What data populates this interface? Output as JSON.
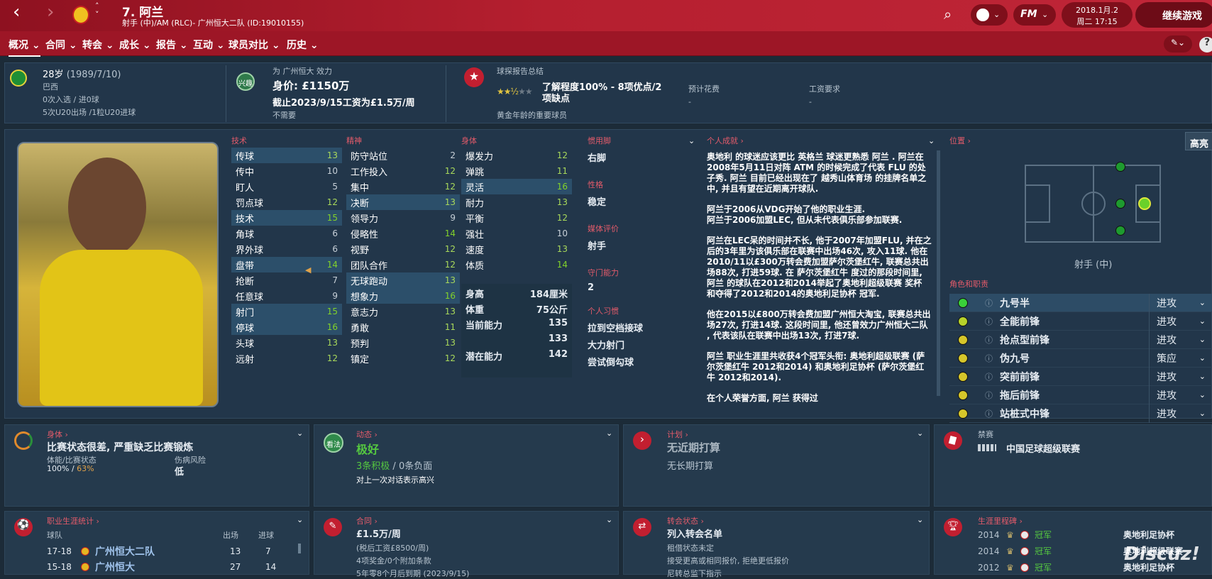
{
  "header": {
    "player_title": "7. 阿兰",
    "subtitle": "射手 (中)/AM (RLC)- 广州恒大二队 (ID:19010155)",
    "date": "2018.1月.2",
    "date2": "周二 17:15",
    "continue": "继续游戏",
    "fm_label": "FM"
  },
  "menu": [
    "概况",
    "合同",
    "转会",
    "成长",
    "报告",
    "互动",
    "球员对比",
    "历史"
  ],
  "info": {
    "age": "28岁",
    "dob": "(1989/7/10)",
    "nation": "巴西",
    "caps": "0次入选 / 进0球",
    "u20": "5次U20出场 /1粒U20进球",
    "club_line": "为 广州恒大 效力",
    "value": "身价: £1150万",
    "contract_line": "截止2023/9/15工资为£1.5万/周",
    "need": "不需要",
    "club_badge": "兴趣",
    "scout_title": "球探报告总结",
    "knowledge": "了解程度100% - 8项优点/2项缺点",
    "scout_desc": "黄金年龄的重要球员",
    "fee_label": "预计花费",
    "fee_val": "-",
    "wage_label": "工资要求",
    "wage_val": "-"
  },
  "attrs": {
    "tech_title": "技术",
    "mental_title": "精神",
    "phys_title": "身体",
    "tech": [
      [
        "传球",
        "13"
      ],
      [
        "传中",
        "10"
      ],
      [
        "盯人",
        "5"
      ],
      [
        "罚点球",
        "12"
      ],
      [
        "技术",
        "15"
      ],
      [
        "角球",
        "6"
      ],
      [
        "界外球",
        "6"
      ],
      [
        "盘带",
        "14"
      ],
      [
        "抢断",
        "7"
      ],
      [
        "任意球",
        "9"
      ],
      [
        "射门",
        "15"
      ],
      [
        "停球",
        "16"
      ],
      [
        "头球",
        "13"
      ],
      [
        "远射",
        "12"
      ]
    ],
    "mental": [
      [
        "防守站位",
        "2"
      ],
      [
        "工作投入",
        "12"
      ],
      [
        "集中",
        "12"
      ],
      [
        "决断",
        "13"
      ],
      [
        "领导力",
        "9"
      ],
      [
        "侵略性",
        "14"
      ],
      [
        "视野",
        "12"
      ],
      [
        "团队合作",
        "12"
      ],
      [
        "无球跑动",
        "13"
      ],
      [
        "想象力",
        "16"
      ],
      [
        "意志力",
        "13"
      ],
      [
        "勇敢",
        "11"
      ],
      [
        "预判",
        "13"
      ],
      [
        "镇定",
        "12"
      ]
    ],
    "phys": [
      [
        "爆发力",
        "12"
      ],
      [
        "弹跳",
        "11"
      ],
      [
        "灵活",
        "16"
      ],
      [
        "耐力",
        "13"
      ],
      [
        "平衡",
        "12"
      ],
      [
        "强壮",
        "10"
      ],
      [
        "速度",
        "13"
      ],
      [
        "体质",
        "14"
      ]
    ],
    "height_label": "身高",
    "height": "184厘米",
    "weight_label": "体重",
    "weight": "75公斤",
    "ca_label": "当前能力",
    "ca": "135",
    "ca2": "133",
    "pa_label": "潜在能力",
    "pa": "142"
  },
  "traits": {
    "foot_label": "惯用脚",
    "foot": "右脚",
    "pers_label": "性格",
    "pers": "稳定",
    "media_label": "媒体评价",
    "media": "射手",
    "gk_label": "守门能力",
    "gk": "2",
    "habit_label": "个人习惯",
    "habits": [
      "拉到空档接球",
      "大力射门",
      "尝试倒勾球"
    ]
  },
  "bio": {
    "title": "个人成就 ›",
    "paras": [
      "奥地利 的球迷应该更比 英格兰 球迷更熟悉 阿兰 . 阿兰在2008年5月11日对阵 ATM 的时候完成了代表 FLU 的处子秀. 阿兰 目前已经出现在了 越秀山体育场 的挂牌名单之中, 并且有望在近期离开球队.",
      "阿兰于2006从VDG开始了他的职业生涯.\n阿兰于2006加盟LEC, 但从未代表俱乐部参加联赛.",
      "阿兰在LEC呆的时间并不长, 他于2007年加盟FLU, 并在之后的3年里为该俱乐部在联赛中出场46次, 攻入11球. 他在2010/11以£300万转会费加盟萨尔茨堡红牛, 联赛总共出场88次, 打进59球. 在 萨尔茨堡红牛 度过的那段时间里, 阿兰 的球队在2012和2014举起了奥地利超级联赛 奖杯 和夺得了2012和2014的奥地利足协杯 冠军.",
      "他在2015以£800万转会费加盟广州恒大淘宝, 联赛总共出场27次, 打进14球. 这段时间里, 他还曾效力广州恒大二队 , 代表该队在联赛中出场13次, 打进7球.",
      "阿兰 职业生涯里共收获4个冠军头衔: 奥地利超级联赛 (萨尔茨堡红牛 2012和2014) 和奥地利足协杯 (萨尔茨堡红牛 2012和2014).",
      "在个人荣誉方面, 阿兰 获得过"
    ]
  },
  "position": {
    "title": "位置 ›",
    "name": "射手 (中)",
    "highlight": "高亮",
    "roles_title": "角色和职责",
    "roles": [
      [
        "九号半",
        "进攻",
        "#3ad13a"
      ],
      [
        "全能前锋",
        "进攻",
        "#b8d22a"
      ],
      [
        "抢点型前锋",
        "进攻",
        "#d6c62a"
      ],
      [
        "伪九号",
        "策应",
        "#d6c62a"
      ],
      [
        "突前前锋",
        "进攻",
        "#d6c62a"
      ],
      [
        "拖后前锋",
        "进攻",
        "#d6c62a"
      ],
      [
        "站桩式中锋",
        "进攻",
        "#d6c62a"
      ]
    ]
  },
  "cards": {
    "phys": {
      "title": "身体 ›",
      "headline": "比赛状态很差, 严重缺乏比赛锻炼",
      "fit_label": "体能/比赛状态",
      "fit": "100%",
      "sharp": "63%",
      "inj_label": "伤病风险",
      "inj": "低"
    },
    "morale": {
      "title": "动态 ›",
      "badge": "看法",
      "headline": "极好",
      "pos": "3条积极",
      "neg": "0条负面",
      "line": "对上一次对话表示高兴"
    },
    "plan": {
      "title": "计划 ›",
      "headline": "无近期打算",
      "line": "无长期打算"
    },
    "ban": {
      "title": "禁赛",
      "line": "中国足球超级联赛"
    },
    "career": {
      "title": "职业生涯统计 ›",
      "col_team": "球队",
      "col_apps": "出场",
      "col_goals": "进球",
      "rows": [
        [
          "17-18",
          "广州恒大二队",
          "13",
          "7"
        ],
        [
          "15-18",
          "广州恒大",
          "27",
          "14"
        ]
      ]
    },
    "contract": {
      "title": "合同 ›",
      "wage": "£1.5万/周",
      "net": "(税后工资£8500/周)",
      "bonus": "4项奖金/0个附加条款",
      "expiry": "5年零8个月后到期 (2023/9/15)"
    },
    "transfer": {
      "title": "转会状态 ›",
      "headline": "列入转会名单",
      "loan": "租借状态未定",
      "offer": "接受更高或相同报价, 拒绝更低报价",
      "ask": "尼转总监下指示"
    },
    "honours": {
      "title": "生涯里程碑 ›",
      "rows": [
        [
          "2014",
          "冠军",
          "奥地利足协杯"
        ],
        [
          "2014",
          "冠军",
          "奥地利超级联赛"
        ],
        [
          "2012",
          "冠军",
          "奥地利足协杯"
        ]
      ]
    }
  },
  "watermark": "Discuz!"
}
